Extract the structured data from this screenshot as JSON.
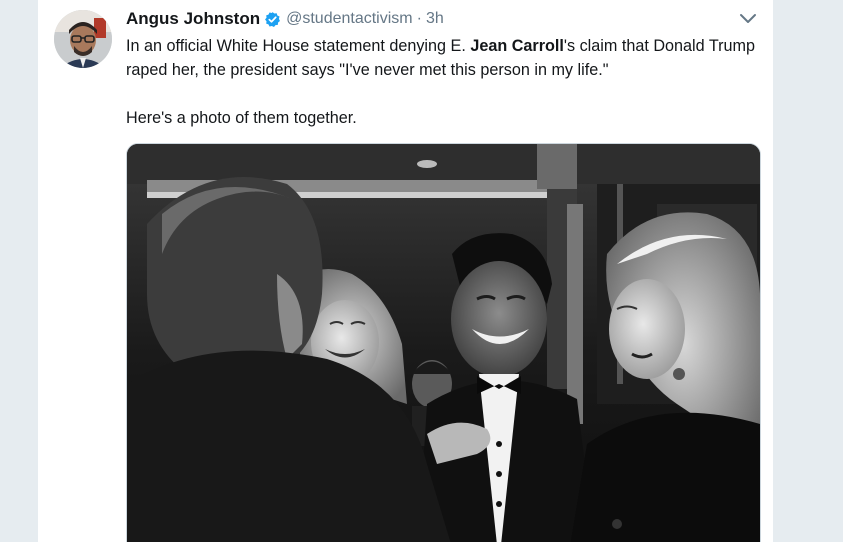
{
  "tweet": {
    "author": {
      "display_name": "Angus Johnston",
      "handle": "@studentactivism",
      "verified": true,
      "avatar_icon": "user-avatar"
    },
    "separator": "·",
    "timestamp": "3h",
    "menu_icon": "chevron-down-icon",
    "text": {
      "line1_prefix": "In an official White House statement denying E. ",
      "line1_bold": "Jean Carroll",
      "line1_suffix": "'s claim that Donald Trump raped her, the president says \"I've never met this person in my life.\"",
      "line2": "Here's a photo of them together."
    },
    "media": {
      "type": "photo",
      "style": "black-and-white"
    }
  },
  "colors": {
    "page_background": "#e6ecf0",
    "card_background": "#ffffff",
    "text_primary": "#14171a",
    "text_secondary": "#657786",
    "verified_blue": "#1da1f2"
  }
}
